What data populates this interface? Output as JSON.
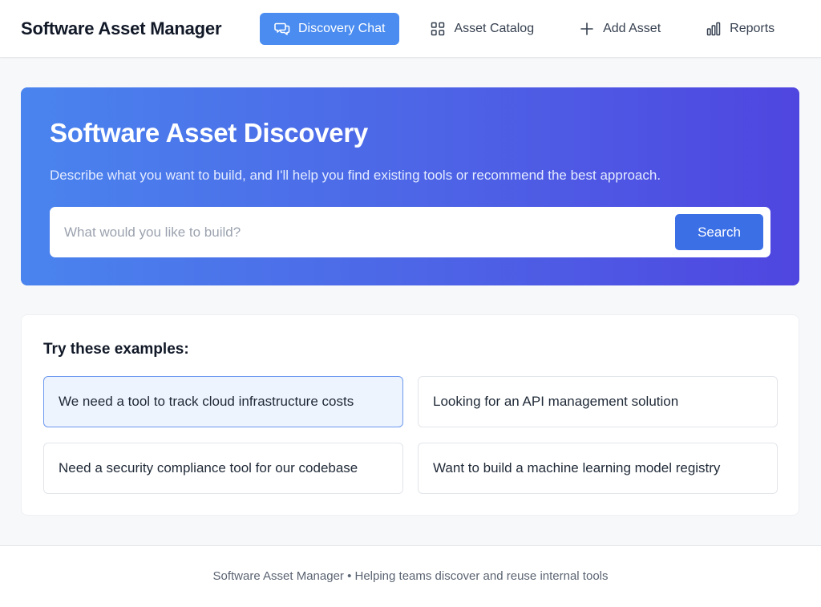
{
  "header": {
    "app_title": "Software Asset Manager",
    "nav": [
      {
        "label": "Discovery Chat",
        "icon": "chat-icon",
        "active": true
      },
      {
        "label": "Asset Catalog",
        "icon": "grid-icon",
        "active": false
      },
      {
        "label": "Add Asset",
        "icon": "plus-icon",
        "active": false
      },
      {
        "label": "Reports",
        "icon": "bar-chart-icon",
        "active": false
      }
    ]
  },
  "hero": {
    "title": "Software Asset Discovery",
    "subtitle": "Describe what you want to build, and I'll help you find existing tools or recommend the best approach.",
    "search": {
      "placeholder": "What would you like to build?",
      "value": "",
      "button_label": "Search"
    }
  },
  "examples": {
    "title": "Try these examples:",
    "items": [
      "We need a tool to track cloud infrastructure costs",
      "Looking for an API management solution",
      "Need a security compliance tool for our codebase",
      "Want to build a machine learning model registry"
    ]
  },
  "footer": {
    "text": "Software Asset Manager • Helping teams discover and reuse internal tools"
  },
  "colors": {
    "accent": "#4a8cf0",
    "search_button": "#3b6fe6",
    "hero_gradient_start": "#4a84ee",
    "hero_gradient_end": "#4f46e0",
    "example_highlight_bg": "#eef4fe",
    "example_highlight_border": "#6c98ee"
  }
}
